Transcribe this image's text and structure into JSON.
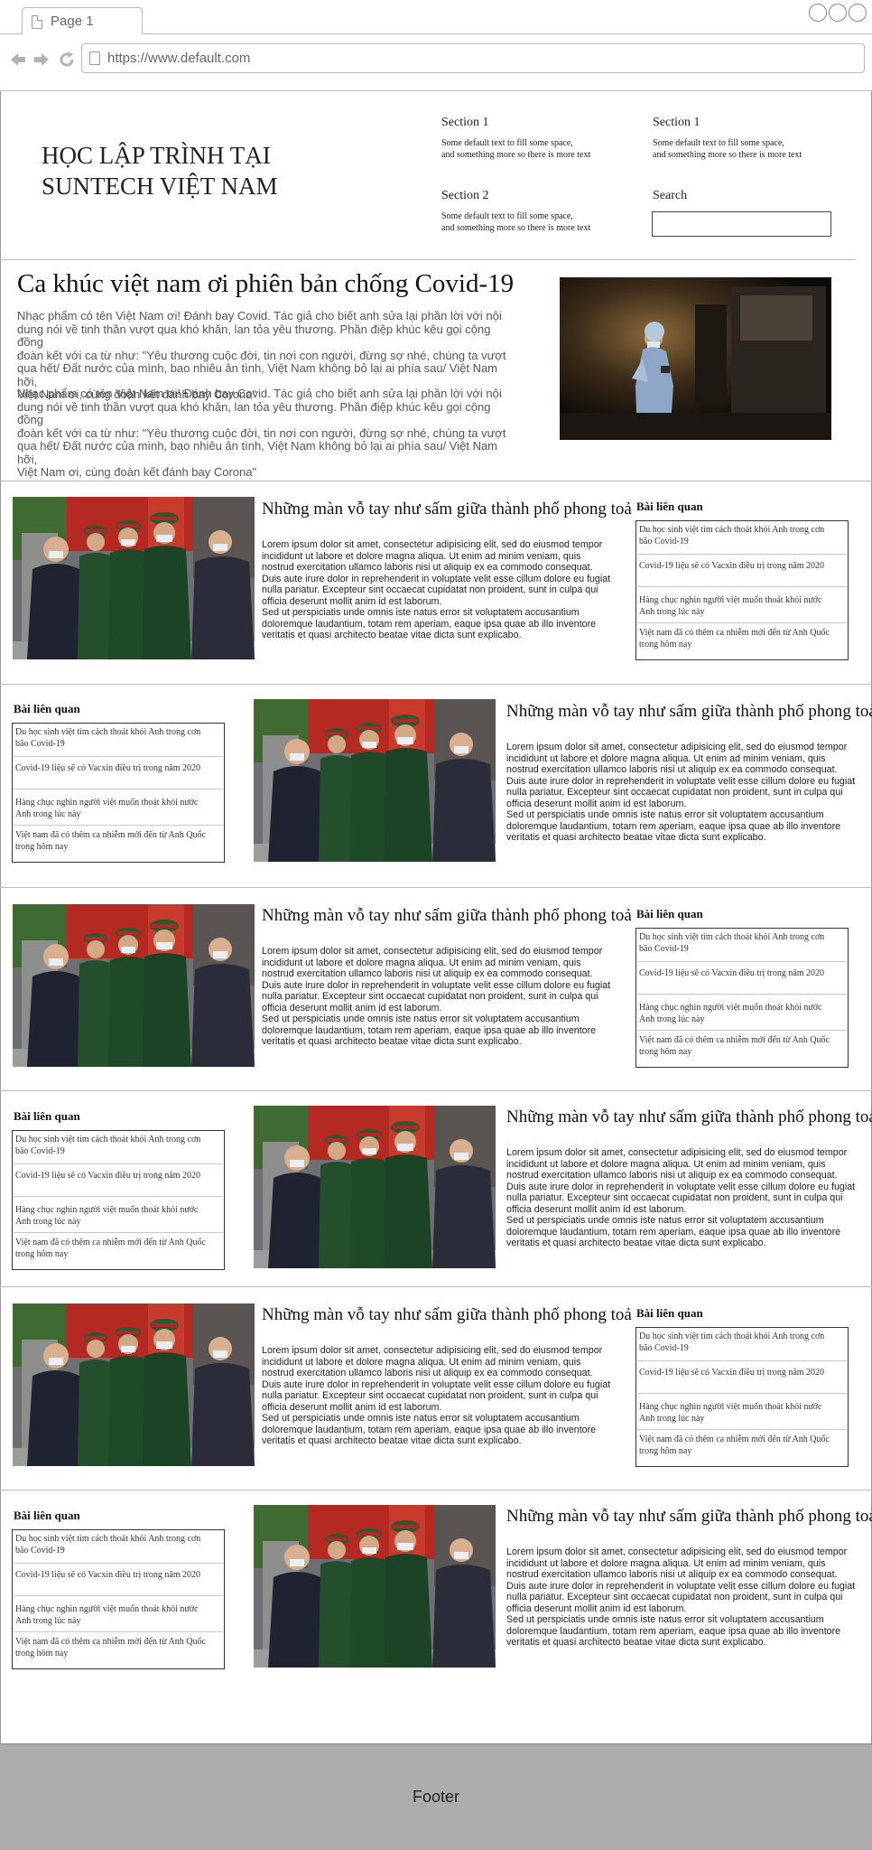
{
  "browser": {
    "tab_title": "Page 1",
    "url": "https://www.default.com",
    "icons": [
      "back-arrow-icon",
      "forward-arrow-icon",
      "reload-icon",
      "page-icon"
    ]
  },
  "header": {
    "logo_line1": "HỌC LẬP TRÌNH TẠI",
    "logo_line2": "SUNTECH VIỆT NAM",
    "sections": [
      {
        "title": "Section 1",
        "text_line1": "Some default text to fill some space,",
        "text_line2": "and something more so there is more text"
      },
      {
        "title": "Section 1",
        "text_line1": "Some default text to fill some space,",
        "text_line2": "and something more so there is more text"
      },
      {
        "title": "Section 2",
        "text_line1": "Some default text to fill some space,",
        "text_line2": "and something more so there is more text"
      }
    ],
    "search_label": "Search",
    "search_value": ""
  },
  "hero": {
    "title": "Ca khúc việt nam ơi phiên bản chống Covid-19",
    "p1": [
      "Nhạc phẩm có tên Việt Nam ơi! Đánh bay Covid. Tác giả cho biết anh sửa lại phần lời với nội",
      "dung nói về tinh thần vượt qua khó khăn, lan tỏa yêu thương. Phần điệp khúc kêu gọi cộng đồng",
      "đoàn kết với ca từ như: \"Yêu thương cuộc đời, tin nơi con người, đừng sợ nhé, chúng ta vượt",
      "qua hết/ Đất nước của mình, bao nhiêu ân tình, Việt Nam không bỏ lại ai phía sau/ Việt Nam hỡi,",
      "Việt Nam ơi, cùng đoàn kết đánh bay Corona\""
    ],
    "p2": [
      "Nhạc phẩm có tên Việt Nam ơi! Đánh bay Covid. Tác giả cho biết anh sửa lại phần lời với nội",
      "dung nói về tinh thần vượt qua khó khăn, lan tỏa yêu thương. Phần điệp khúc kêu gọi cộng đồng",
      "đoàn kết với ca từ như: \"Yêu thương cuộc đời, tin nơi con người, đừng sợ nhé, chúng ta vượt",
      "qua hết/ Đất nước của mình, bao nhiêu ân tình, Việt Nam không bỏ lại ai phía sau/ Việt Nam hỡi,",
      "Việt Nam ơi, cùng đoàn kết đánh bay Corona\""
    ]
  },
  "article": {
    "title": "Những màn vỗ tay như sấm giữa thành phố phong toả",
    "body": [
      "Lorem ipsum dolor sit amet, consectetur adipisicing elit, sed do eiusmod tempor",
      "incididunt ut labore et dolore magna aliqua. Ut enim ad minim veniam, quis",
      "nostrud exercitation ullamco laboris nisi ut aliquip ex ea commodo consequat.",
      "Duis aute irure dolor in reprehenderit in voluptate velit esse cillum dolore eu fugiat",
      "nulla pariatur. Excepteur sint occaecat cupidatat non proident, sunt in culpa qui",
      "officia deserunt mollit anim id est laborum.",
      "Sed ut perspiciatis unde omnis iste natus error sit voluptatem accusantium",
      "doloremque laudantium, totam rem aperiam, eaque ipsa quae ab illo inventore",
      "veritatis et quasi architecto beatae vitae dicta sunt explicabo."
    ]
  },
  "related": {
    "title": "Bài liên quan",
    "items": [
      [
        "Du học sinh việt tìm cách thoát khỏi Anh trong cơn",
        "bão Covid-19"
      ],
      [
        "Covid-19 liệu sẽ có Vacxin điều trị trong năm 2020"
      ],
      [
        "Hàng chục nghìn người việt muốn thoát khỏi nước",
        "Anh trong lúc này"
      ],
      [
        "Việt nam đã có thêm ca nhiễm mới đến từ Anh Quốc",
        "trong hôm nay"
      ]
    ]
  },
  "footer": {
    "label": "Footer"
  },
  "colors": {
    "footer_bg": "#adadad",
    "border": "#bbbbbb",
    "army_green": "#1f4a2a",
    "flag_red": "#c2241c"
  }
}
